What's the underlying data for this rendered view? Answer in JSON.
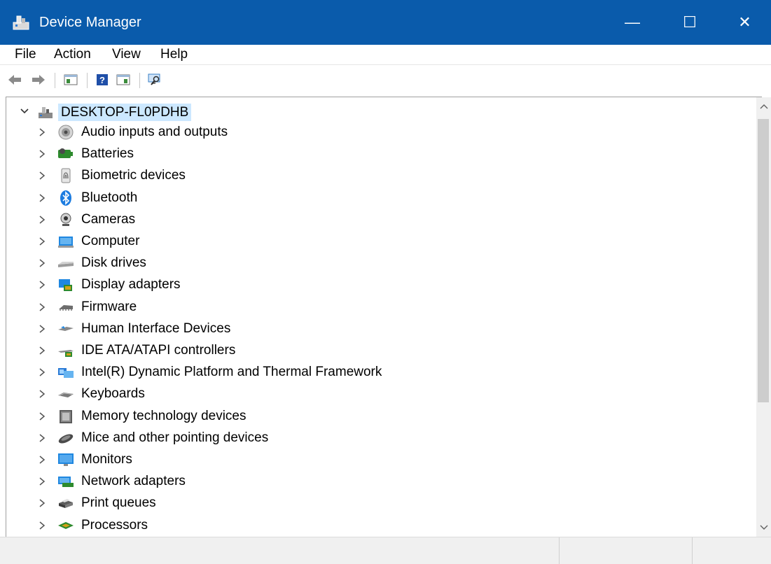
{
  "window": {
    "title": "Device Manager",
    "minimize_glyph": "—",
    "maximize_glyph": "☐",
    "close_glyph": "✕",
    "title_color": "#0a5bab"
  },
  "menu": [
    {
      "label": "File"
    },
    {
      "label": "Action"
    },
    {
      "label": "View"
    },
    {
      "label": "Help"
    }
  ],
  "toolbar": {
    "buttons": [
      {
        "icon": "back-arrow-icon"
      },
      {
        "icon": "forward-arrow-icon"
      },
      {
        "icon": "show-hide-console-tree-icon"
      },
      {
        "icon": "help-icon"
      },
      {
        "icon": "properties-pane-icon"
      },
      {
        "icon": "scan-hardware-icon"
      }
    ]
  },
  "tree": {
    "root": {
      "label": "DESKTOP-FL0PDHB",
      "icon": "computer-network-icon",
      "expanded": true
    },
    "items": [
      {
        "label": "Audio inputs and outputs",
        "icon": "speaker-icon"
      },
      {
        "label": "Batteries",
        "icon": "battery-icon"
      },
      {
        "label": "Biometric devices",
        "icon": "fingerprint-icon"
      },
      {
        "label": "Bluetooth",
        "icon": "bluetooth-icon"
      },
      {
        "label": "Cameras",
        "icon": "webcam-icon"
      },
      {
        "label": "Computer",
        "icon": "computer-icon"
      },
      {
        "label": "Disk drives",
        "icon": "disk-drive-icon"
      },
      {
        "label": "Display adapters",
        "icon": "display-adapter-icon"
      },
      {
        "label": "Firmware",
        "icon": "firmware-chip-icon"
      },
      {
        "label": "Human Interface Devices",
        "icon": "hid-icon"
      },
      {
        "label": "IDE ATA/ATAPI controllers",
        "icon": "ide-controller-icon"
      },
      {
        "label": "Intel(R) Dynamic Platform and Thermal Framework",
        "icon": "thermal-framework-icon"
      },
      {
        "label": "Keyboards",
        "icon": "keyboard-icon"
      },
      {
        "label": "Memory technology devices",
        "icon": "memory-device-icon"
      },
      {
        "label": "Mice and other pointing devices",
        "icon": "mouse-icon"
      },
      {
        "label": "Monitors",
        "icon": "monitor-icon"
      },
      {
        "label": "Network adapters",
        "icon": "network-adapter-icon"
      },
      {
        "label": "Print queues",
        "icon": "printer-icon"
      },
      {
        "label": "Processors",
        "icon": "processor-icon"
      }
    ]
  }
}
